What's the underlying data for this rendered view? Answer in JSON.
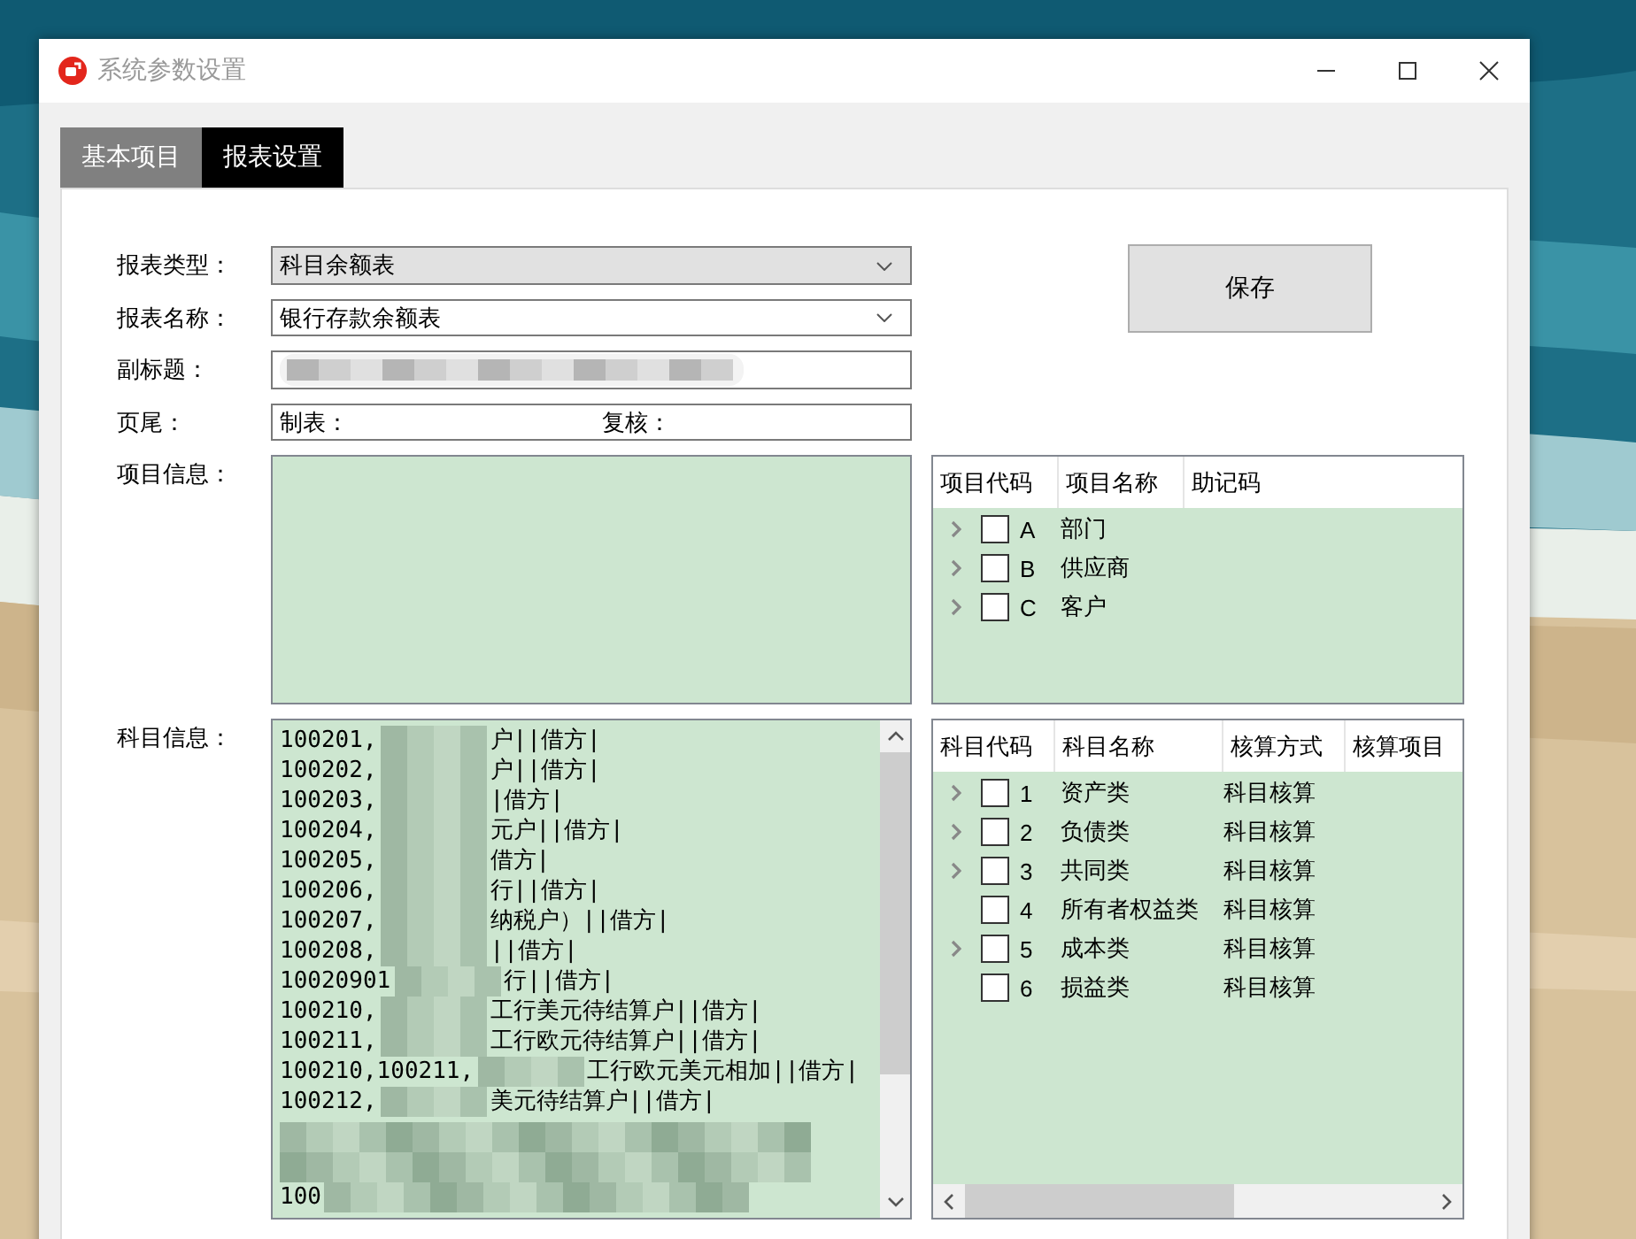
{
  "window": {
    "title": "系统参数设置"
  },
  "tabs": [
    {
      "label": "基本项目",
      "selected": false
    },
    {
      "label": "报表设置",
      "selected": true
    }
  ],
  "fields": [
    {
      "kind": "combo",
      "label": "报表类型：",
      "value": "科目余额表",
      "disabled": true
    },
    {
      "kind": "combo",
      "label": "报表名称：",
      "value": "银行存款余额表",
      "disabled": false
    },
    {
      "kind": "text",
      "label": "副标题："
    },
    {
      "kind": "footer",
      "label": "页尾：",
      "parts": [
        "制表：",
        "复核："
      ]
    }
  ],
  "save_button": "保存",
  "item_info": {
    "label": "项目信息："
  },
  "item_tree": {
    "columns": [
      "项目代码",
      "项目名称",
      "助记码"
    ],
    "rows": [
      {
        "code": "A",
        "name": "部门",
        "expandable": true,
        "checked": false
      },
      {
        "code": "B",
        "name": "供应商",
        "expandable": true,
        "checked": false
      },
      {
        "code": "C",
        "name": "客户",
        "expandable": true,
        "checked": false
      }
    ]
  },
  "subject_info": {
    "label": "科目信息：",
    "lines": [
      {
        "code": "100201,",
        "tail": "户||借方|"
      },
      {
        "code": "100202,",
        "tail": "户||借方|"
      },
      {
        "code": "100203,",
        "tail": "|借方|"
      },
      {
        "code": "100204,",
        "tail": "元户||借方|"
      },
      {
        "code": "100205,",
        "tail": "借方|"
      },
      {
        "code": "100206,",
        "tail": "行||借方|"
      },
      {
        "code": "100207,",
        "tail": "纳税户）||借方|"
      },
      {
        "code": "100208,",
        "tail": "||借方|"
      },
      {
        "code": "10020901",
        "tail": "行||借方|"
      },
      {
        "code": "100210,",
        "tail": "工行美元待结算户||借方|"
      },
      {
        "code": "100211,",
        "tail": "工行欧元待结算户||借方|"
      },
      {
        "code": "100210,100211,",
        "tail": "工行欧元美元相加||借方|"
      },
      {
        "code": "100212,",
        "tail": "美元待结算户||借方|"
      },
      {
        "code": "100"
      }
    ]
  },
  "subject_tree": {
    "columns": [
      "科目代码",
      "科目名称",
      "核算方式",
      "核算项目"
    ],
    "rows": [
      {
        "code": "1",
        "name": "资产类",
        "method": "科目核算",
        "expandable": true,
        "checked": false
      },
      {
        "code": "2",
        "name": "负债类",
        "method": "科目核算",
        "expandable": true,
        "checked": false
      },
      {
        "code": "3",
        "name": "共同类",
        "method": "科目核算",
        "expandable": true,
        "checked": false
      },
      {
        "code": "4",
        "name": "所有者权益类",
        "method": "科目核算",
        "expandable": false,
        "checked": false
      },
      {
        "code": "5",
        "name": "成本类",
        "method": "科目核算",
        "expandable": true,
        "checked": false
      },
      {
        "code": "6",
        "name": "损益类",
        "method": "科目核算",
        "expandable": false,
        "checked": false
      }
    ]
  }
}
